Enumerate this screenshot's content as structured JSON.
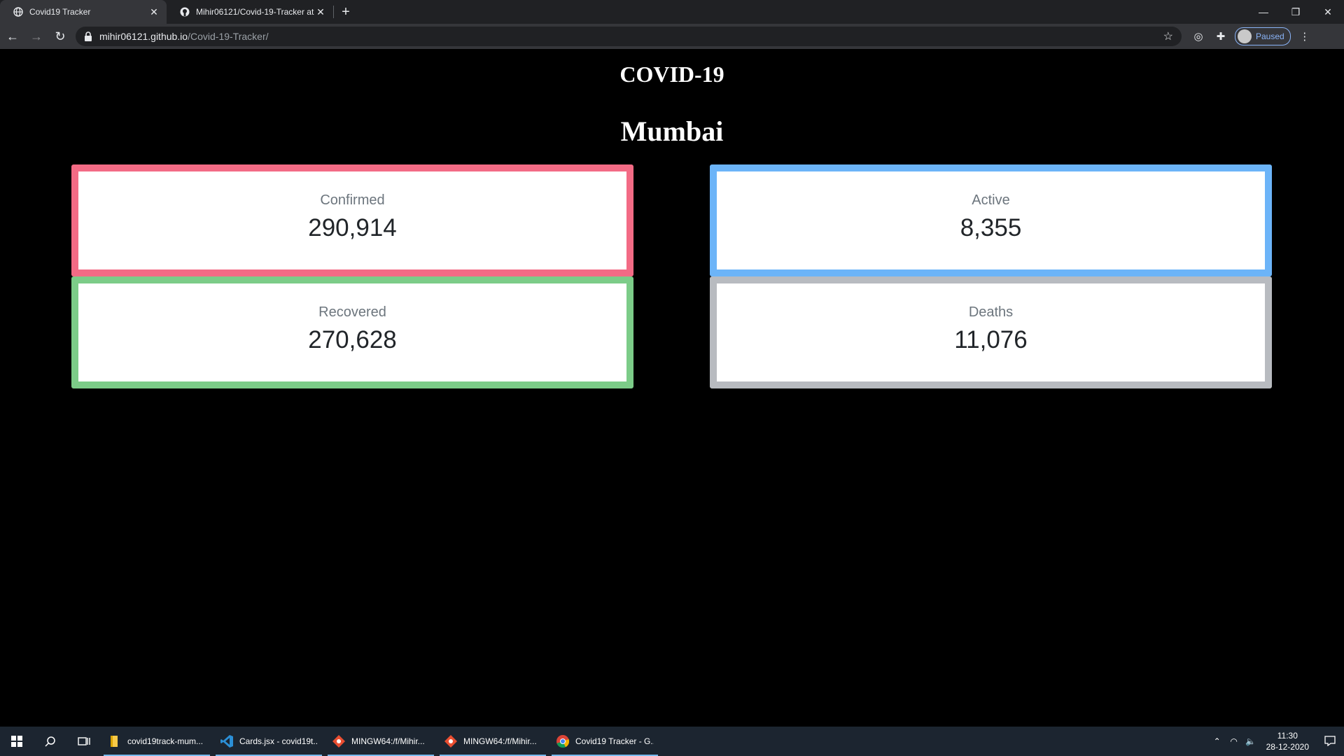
{
  "browser": {
    "tabs": [
      {
        "title": "Covid19 Tracker",
        "active": true
      },
      {
        "title": "Mihir06121/Covid-19-Tracker at",
        "active": false
      }
    ],
    "url_host": "mihir06121.github.io",
    "url_path": "/Covid-19-Tracker/",
    "profile_label": "Paused"
  },
  "page": {
    "heading": "COVID-19",
    "city": "Mumbai",
    "cards": [
      {
        "label": "Confirmed",
        "value": "290,914",
        "color": "#f36b85"
      },
      {
        "label": "Active",
        "value": "8,355",
        "color": "#6cb4f8"
      },
      {
        "label": "Recovered",
        "value": "270,628",
        "color": "#7ccc88"
      },
      {
        "label": "Deaths",
        "value": "11,076",
        "color": "#b8bbc0"
      }
    ]
  },
  "taskbar": {
    "apps": [
      {
        "title": "covid19track-mum...",
        "icon": "folder-icon"
      },
      {
        "title": "Cards.jsx - covid19t...",
        "icon": "vscode-icon"
      },
      {
        "title": "MINGW64:/f/Mihir...",
        "icon": "git-bash-icon"
      },
      {
        "title": "MINGW64:/f/Mihir...",
        "icon": "git-bash-icon"
      },
      {
        "title": "Covid19 Tracker - G...",
        "icon": "chrome-icon"
      }
    ],
    "time": "11:30",
    "date": "28-12-2020"
  }
}
